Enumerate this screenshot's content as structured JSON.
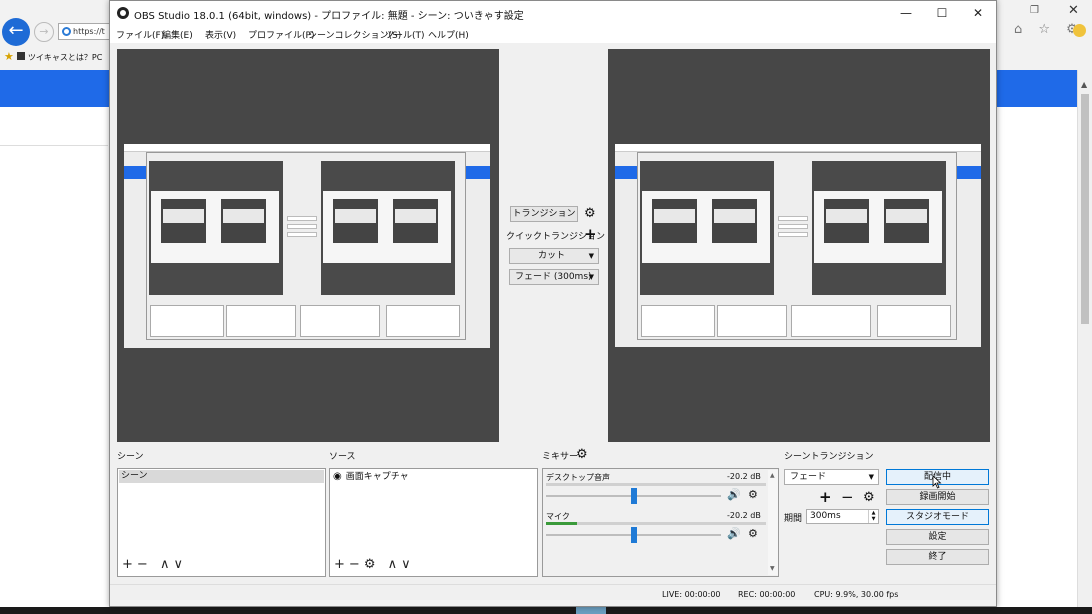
{
  "browser": {
    "url_fragment": "https://t",
    "favorite_label": "ツイキャスとは？PC",
    "back_icon": "arrow-left-icon",
    "nav_icons": "⌂ ☆ ⚙"
  },
  "window": {
    "title": "OBS Studio 18.0.1 (64bit, windows) - プロファイル: 無題 - シーン: ついきゃす設定",
    "minimize": "—",
    "maximize": "☐",
    "close": "✕"
  },
  "menu": [
    "ファイル(F)",
    "編集(E)",
    "表示(V)",
    "プロファイル(P)",
    "シーンコレクション(S)",
    "ツール(T)",
    "ヘルプ(H)"
  ],
  "transition": {
    "button_label": "トランジション",
    "quick_label": "クイックトランジション",
    "cut_label": "カット",
    "fade_label": "フェード (300ms)"
  },
  "scenes": {
    "title": "シーン",
    "items": [
      "シーン"
    ]
  },
  "sources": {
    "title": "ソース",
    "items": [
      {
        "name": "画面キャプチャ",
        "visible_icon": "eye-icon"
      }
    ]
  },
  "mixer": {
    "title": "ミキサー",
    "tracks": [
      {
        "name": "デスクトップ音声",
        "db": "-20.2 dB",
        "level": 0.0,
        "volume": 0.5
      },
      {
        "name": "マイク",
        "db": "-20.2 dB",
        "level": 0.14,
        "volume": 0.5
      }
    ]
  },
  "scene_transitions": {
    "title": "シーントランジション",
    "selected": "フェード",
    "duration_label": "期間",
    "duration_value": "300ms"
  },
  "controls": {
    "streaming": "配信中",
    "recording": "録画開始",
    "studio_mode": "スタジオモード",
    "settings": "設定",
    "exit": "終了"
  },
  "status": {
    "live": "LIVE: 00:00:00",
    "rec": "REC: 00:00:00",
    "cpu": "CPU: 9.9%, 30.00 fps"
  }
}
